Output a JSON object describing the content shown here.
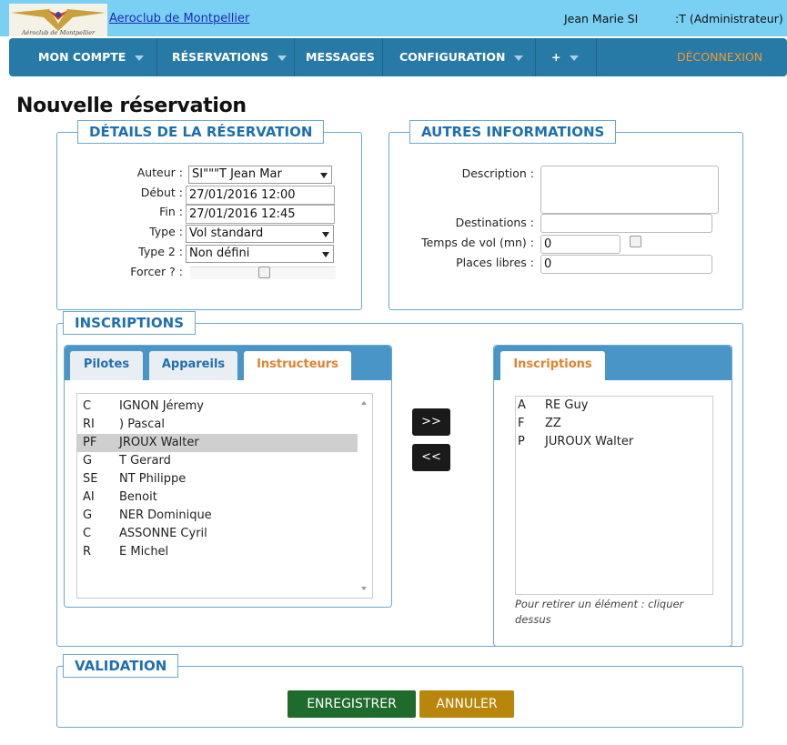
{
  "header": {
    "club_name": "Aeroclub de Montpellier",
    "logo_text": "Aéroclub de Montpellier",
    "user_name": "Jean Marie SI",
    "user_role": ":T (Administrateur)"
  },
  "nav": {
    "items": [
      {
        "label": "MON COMPTE"
      },
      {
        "label": "RÉSERVATIONS"
      },
      {
        "label": "MESSAGES"
      },
      {
        "label": "CONFIGURATION"
      },
      {
        "label": "+"
      }
    ],
    "logout": "DÉCONNEXION"
  },
  "page": {
    "title": "Nouvelle réservation"
  },
  "details": {
    "legend": "DÉTAILS DE LA RÉSERVATION",
    "auteur_label": "Auteur :",
    "auteur_value": "SI\"\"\"T Jean Mar",
    "debut_label": "Début :",
    "debut_value": "27/01/2016 12:00",
    "fin_label": "Fin :",
    "fin_value": "27/01/2016 12:45",
    "type_label": "Type :",
    "type_value": "Vol standard",
    "type2_label": "Type 2 :",
    "type2_value": "Non défini",
    "forcer_label": "Forcer ? :"
  },
  "autres": {
    "legend": "AUTRES INFORMATIONS",
    "description_label": "Description :",
    "description_value": "",
    "destinations_label": "Destinations :",
    "destinations_value": "",
    "temps_label": "Temps de vol (mn) :",
    "temps_value": "0",
    "places_label": "Places libres :",
    "places_value": "0"
  },
  "inscriptions": {
    "legend": "INSCRIPTIONS",
    "tabs": [
      {
        "label": "Pilotes"
      },
      {
        "label": "Appareils"
      },
      {
        "label": "Instructeurs"
      }
    ],
    "active_tab": "Instructeurs",
    "instructors": [
      {
        "initial": "C",
        "name": "IGNON Jéremy"
      },
      {
        "initial": "RI",
        "name": ") Pascal"
      },
      {
        "initial": "PF",
        "name": "JROUX Walter"
      },
      {
        "initial": "G",
        "name": "T Gerard"
      },
      {
        "initial": "SE",
        "name": "NT Philippe"
      },
      {
        "initial": "AI",
        "name": "Benoit"
      },
      {
        "initial": "G",
        "name": "NER Dominique"
      },
      {
        "initial": "C",
        "name": "ASSONNE Cyril"
      },
      {
        "initial": "R",
        "name": "E Michel"
      }
    ],
    "add_button": ">>",
    "remove_button": "<<",
    "right_tab": "Inscriptions",
    "registered": [
      {
        "initial": "A",
        "name": "RE Guy"
      },
      {
        "initial": "F",
        "name": "ZZ"
      },
      {
        "initial": "P",
        "name": "JUROUX Walter"
      }
    ],
    "hint": "Pour retirer un élément : cliquer dessus"
  },
  "validation": {
    "legend": "VALIDATION",
    "save": "ENREGISTRER",
    "cancel": "ANNULER"
  }
}
